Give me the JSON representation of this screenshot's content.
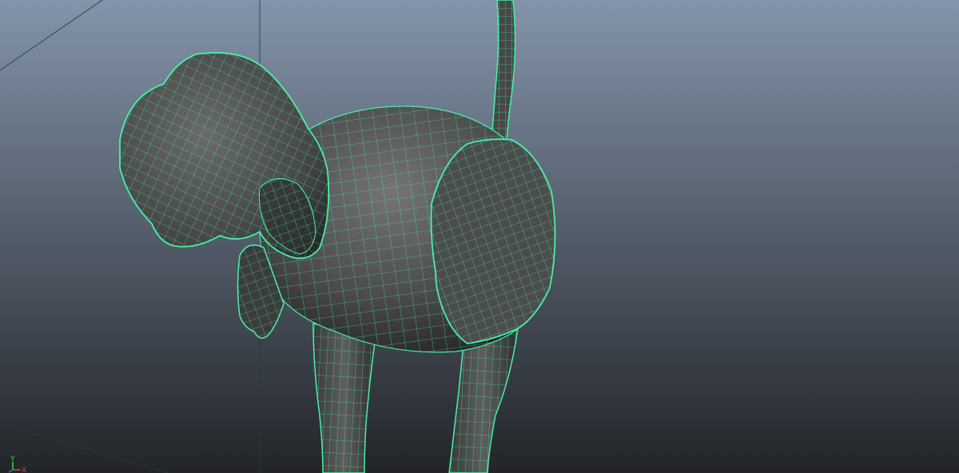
{
  "viewport": {
    "type": "3d-perspective-viewport",
    "shading": "smooth-shade-with-wireframe-on-shaded",
    "selected_object": "elephant-mesh",
    "colors": {
      "background_top": "#8394aa",
      "background_bottom": "#222428",
      "wireframe_selected": "#46f0a8",
      "mesh_shade_light": "#6e6e6e",
      "mesh_shade_dark": "#2c2c2c",
      "grid_line": "#1e3a3a"
    }
  },
  "axis_gizmo": {
    "x_label": "X",
    "y_label": "Y",
    "x_color": "#e04040",
    "y_color": "#40d040",
    "z_color": "#4060e0"
  }
}
